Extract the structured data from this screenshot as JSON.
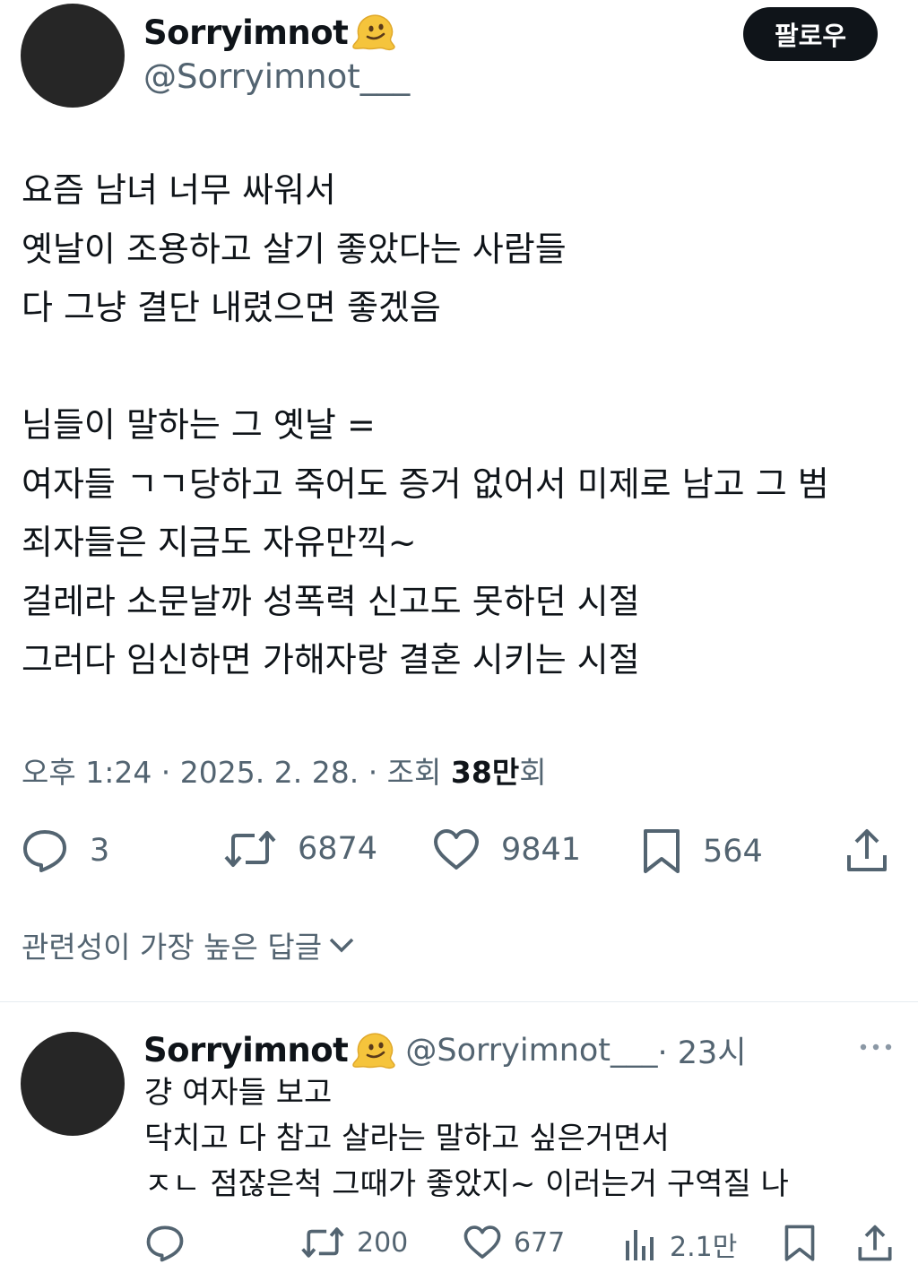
{
  "tweet": {
    "author_name": "Sorryimnot",
    "author_handle": "@Sorryimnot___",
    "follow_label": "팔로우",
    "body_lines": [
      "요즘 남녀 너무 싸워서",
      "옛날이 조용하고 살기 좋았다는 사람들",
      "다 그냥 결단 내렸으면 좋겠음",
      "",
      "님들이 말하는 그 옛날 =",
      "여자들 ㄱㄱ당하고 죽어도 증거 없어서 미제로 남고 그 범",
      "죄자들은 지금도 자유만끽~",
      "걸레라 소문날까 성폭력 신고도 못하던 시절",
      "그러다 임신하면 가해자랑 결혼 시키는 시절"
    ],
    "meta_prefix": "오후 1:24 · 2025. 2. 28. · 조회 ",
    "views_number": "38만",
    "views_suffix": "회",
    "stats": {
      "replies": "3",
      "retweets": "6874",
      "likes": "9841",
      "bookmarks": "564"
    }
  },
  "replies_filter_label": "관련성이 가장 높은 답글",
  "reply": {
    "author_name": "Sorryimnot",
    "author_handle": "@Sorryimnot___",
    "time": " · 23시",
    "body_lines": [
      "걍 여자들 보고",
      "닥치고 다 참고 살라는 말하고 싶은거면서",
      "ㅈㄴ 점잖은척 그때가 좋았지~ 이러는거 구역질 나"
    ],
    "stats": {
      "retweets": "200",
      "likes": "677",
      "views": "2.1만"
    }
  },
  "icons": {
    "emoji": "melting-face",
    "reply": "speech-bubble",
    "retweet": "repost-arrows",
    "like": "heart-outline",
    "bookmark": "bookmark-outline",
    "share": "share-upload",
    "views": "bar-chart",
    "more": "ellipsis",
    "chevron": "chevron-down"
  },
  "colors": {
    "text": "#0f1419",
    "secondary": "#536471",
    "follow_bg": "#0f1419",
    "emoji": "#f5c43c"
  }
}
